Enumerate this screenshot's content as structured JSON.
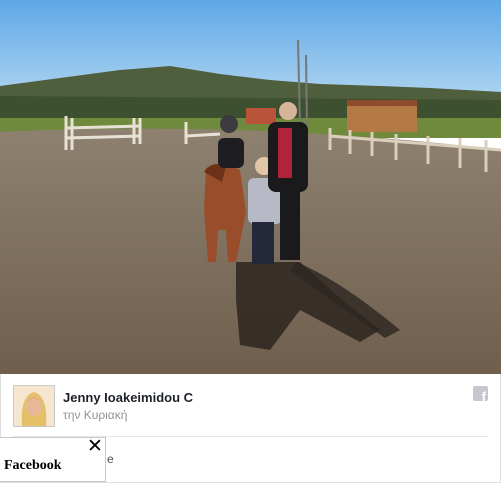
{
  "post": {
    "author": "Jenny Ioakeimidou C",
    "time": "την Κυριακή",
    "more_text": "e"
  },
  "icons": {
    "network": "facebook-icon",
    "close": "close-icon",
    "avatar": "avatar"
  },
  "overlay": {
    "title": "Facebook",
    "close_glyph": "✕"
  },
  "colors": {
    "author": "#1d2129",
    "time": "#90949c",
    "border": "#dddfe2"
  }
}
